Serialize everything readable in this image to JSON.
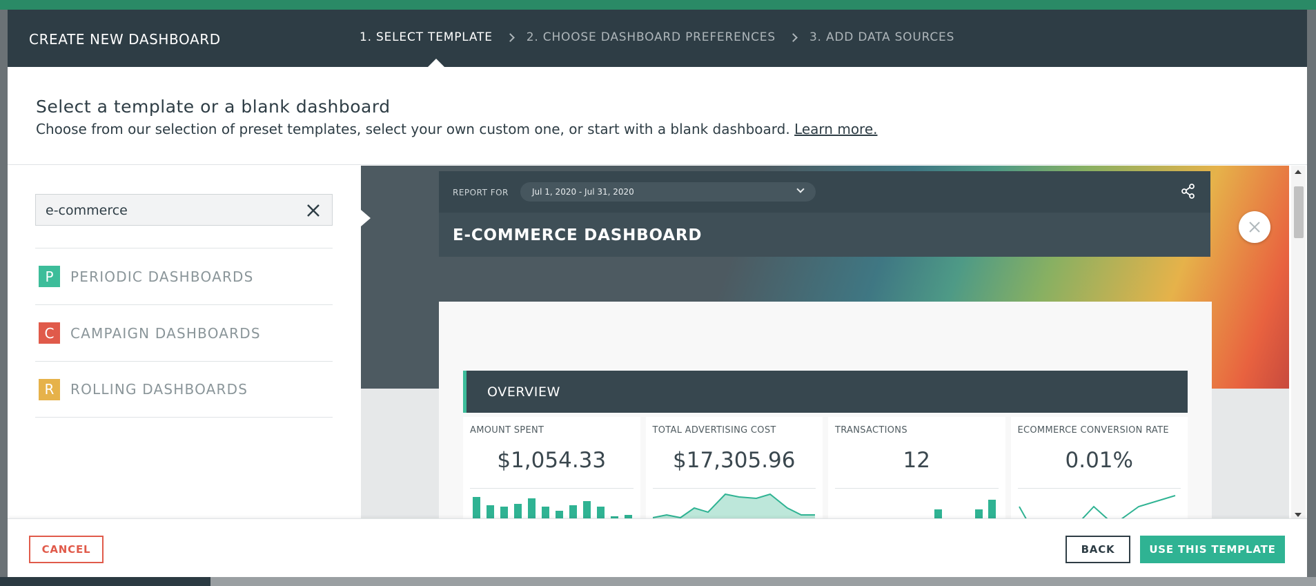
{
  "header": {
    "title": "CREATE NEW DASHBOARD",
    "steps": [
      {
        "label": "1. SELECT TEMPLATE",
        "active": true
      },
      {
        "label": "2. CHOOSE DASHBOARD PREFERENCES",
        "active": false
      },
      {
        "label": "3. ADD DATA SOURCES",
        "active": false
      }
    ]
  },
  "intro": {
    "heading": "Select a template or a blank dashboard",
    "text": "Choose from our selection of preset templates, select your own custom one, or start with a blank dashboard.",
    "link": "Learn more."
  },
  "search": {
    "value": "e-commerce"
  },
  "categories": [
    {
      "letter": "P",
      "label": "PERIODIC DASHBOARDS",
      "color": "#3dbd9a"
    },
    {
      "letter": "C",
      "label": "CAMPAIGN DASHBOARDS",
      "color": "#e05a4a"
    },
    {
      "letter": "R",
      "label": "ROLLING DASHBOARDS",
      "color": "#e6b24a"
    }
  ],
  "preview": {
    "report_for": "REPORT FOR",
    "date_range": "Jul 1, 2020 - Jul 31, 2020",
    "title": "E-COMMERCE DASHBOARD",
    "section": "OVERVIEW",
    "kpis": [
      {
        "label": "AMOUNT SPENT",
        "value": "$1,054.33",
        "chart": "bar"
      },
      {
        "label": "TOTAL ADVERTISING COST",
        "value": "$17,305.96",
        "chart": "area"
      },
      {
        "label": "TRANSACTIONS",
        "value": "12",
        "chart": "bar"
      },
      {
        "label": "ECOMMERCE CONVERSION RATE",
        "value": "0.01%",
        "chart": "line"
      }
    ]
  },
  "footer": {
    "cancel": "CANCEL",
    "back": "BACK",
    "use": "USE THIS TEMPLATE"
  },
  "colors": {
    "accent": "#2fb393",
    "header_bg": "#2e3d45",
    "danger": "#e05a4a"
  }
}
